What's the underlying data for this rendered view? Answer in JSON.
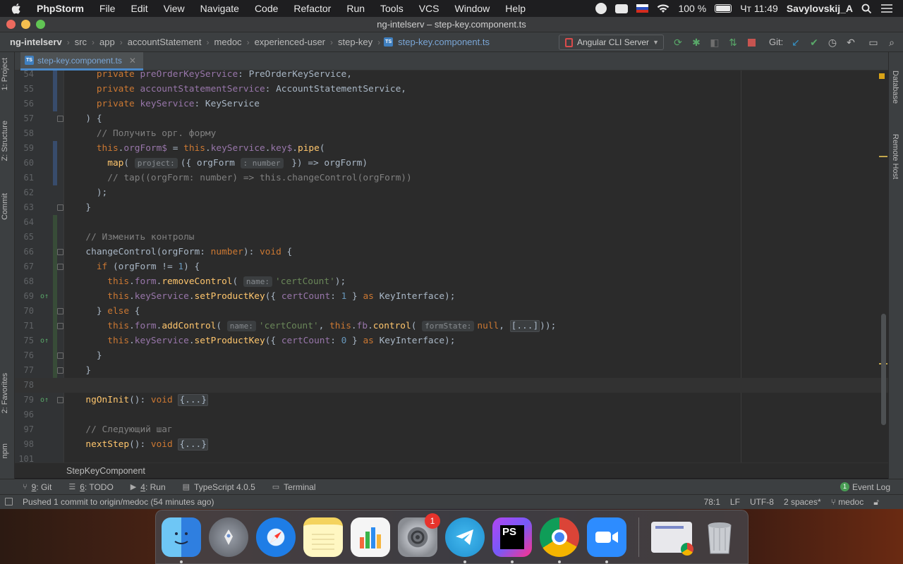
{
  "menubar": {
    "app_name": "PhpStorm",
    "items": [
      "File",
      "Edit",
      "View",
      "Navigate",
      "Code",
      "Refactor",
      "Run",
      "Tools",
      "VCS",
      "Window",
      "Help"
    ],
    "battery": "100 %",
    "clock": "Чт 11:49",
    "user": "Savylovskij_A"
  },
  "window": {
    "title": "ng-intelserv – step-key.component.ts"
  },
  "breadcrumbs": [
    "ng-intelserv",
    "src",
    "app",
    "accountStatement",
    "medoc",
    "experienced-user",
    "step-key",
    "step-key.component.ts"
  ],
  "toolbar": {
    "run_config": "Angular CLI Server",
    "git_label": "Git:"
  },
  "left_tools": [
    "1: Project",
    "Z: Structure",
    "Commit",
    "2: Favorites",
    "npm"
  ],
  "right_tools": [
    "Database",
    "Remote Host"
  ],
  "editor": {
    "tab_label": "step-key.component.ts",
    "lines": [
      {
        "n": "54",
        "vcs": "mod",
        "fold": false,
        "gm": "",
        "tokens": [
          [
            "    ",
            ""
          ],
          [
            "private ",
            "kw"
          ],
          [
            "preOrderKeyService",
            "fld"
          ],
          [
            ": PreOrderKeyService,",
            ""
          ]
        ]
      },
      {
        "n": "55",
        "vcs": "mod",
        "fold": false,
        "gm": "",
        "tokens": [
          [
            "    ",
            ""
          ],
          [
            "private ",
            "kw"
          ],
          [
            "accountStatementService",
            "fld"
          ],
          [
            ": AccountStatementService,",
            ""
          ]
        ]
      },
      {
        "n": "56",
        "vcs": "mod",
        "fold": false,
        "gm": "",
        "tokens": [
          [
            "    ",
            ""
          ],
          [
            "private ",
            "kw"
          ],
          [
            "keyService",
            "fld"
          ],
          [
            ": KeyService",
            ""
          ]
        ]
      },
      {
        "n": "57",
        "vcs": "",
        "fold": true,
        "gm": "",
        "tokens": [
          [
            "  ) {",
            ""
          ]
        ]
      },
      {
        "n": "58",
        "vcs": "",
        "fold": false,
        "gm": "",
        "tokens": [
          [
            "    ",
            ""
          ],
          [
            "// Получить орг. форму",
            "cm"
          ]
        ]
      },
      {
        "n": "59",
        "vcs": "mod",
        "fold": false,
        "gm": "",
        "tokens": [
          [
            "    ",
            ""
          ],
          [
            "this",
            "kw"
          ],
          [
            ".",
            ""
          ],
          [
            "orgForm$",
            "fld"
          ],
          [
            " = ",
            ""
          ],
          [
            "this",
            "kw"
          ],
          [
            ".",
            ""
          ],
          [
            "keyService",
            "fld"
          ],
          [
            ".",
            ""
          ],
          [
            "key$",
            "fld"
          ],
          [
            ".",
            ""
          ],
          [
            "pipe",
            "fn"
          ],
          [
            "(",
            ""
          ]
        ]
      },
      {
        "n": "60",
        "vcs": "mod",
        "fold": false,
        "gm": "",
        "tokens": [
          [
            "      ",
            ""
          ],
          [
            "map",
            "fn"
          ],
          [
            "( ",
            ""
          ],
          [
            "project:",
            "hint"
          ],
          [
            "({ orgForm ",
            ""
          ],
          [
            ": number",
            "hint"
          ],
          [
            " }) => orgForm)",
            ""
          ]
        ]
      },
      {
        "n": "61",
        "vcs": "mod",
        "fold": false,
        "gm": "",
        "tokens": [
          [
            "      ",
            ""
          ],
          [
            "// tap((orgForm: number) => this.changeControl(orgForm))",
            "cm"
          ]
        ]
      },
      {
        "n": "62",
        "vcs": "",
        "fold": false,
        "gm": "",
        "tokens": [
          [
            "    );",
            ""
          ]
        ]
      },
      {
        "n": "63",
        "vcs": "",
        "fold": true,
        "gm": "",
        "tokens": [
          [
            "  }",
            ""
          ]
        ]
      },
      {
        "n": "64",
        "vcs": "add",
        "fold": false,
        "gm": "",
        "tokens": [
          [
            "",
            ""
          ]
        ]
      },
      {
        "n": "65",
        "vcs": "add",
        "fold": false,
        "gm": "",
        "tokens": [
          [
            "  ",
            ""
          ],
          [
            "// Изменить контролы",
            "cm"
          ]
        ]
      },
      {
        "n": "66",
        "vcs": "add",
        "fold": true,
        "gm": "",
        "tokens": [
          [
            "  changeControl(orgForm: ",
            ""
          ],
          [
            "number",
            "kw"
          ],
          [
            "): ",
            ""
          ],
          [
            "void",
            "kw"
          ],
          [
            " {",
            ""
          ]
        ]
      },
      {
        "n": "67",
        "vcs": "add",
        "fold": true,
        "gm": "",
        "tokens": [
          [
            "    ",
            ""
          ],
          [
            "if",
            "kw"
          ],
          [
            " (orgForm != ",
            ""
          ],
          [
            "1",
            "num"
          ],
          [
            ") {",
            ""
          ]
        ]
      },
      {
        "n": "68",
        "vcs": "add",
        "fold": false,
        "gm": "",
        "tokens": [
          [
            "      ",
            ""
          ],
          [
            "this",
            "kw"
          ],
          [
            ".",
            ""
          ],
          [
            "form",
            "fld"
          ],
          [
            ".",
            ""
          ],
          [
            "removeControl",
            "fn"
          ],
          [
            "( ",
            ""
          ],
          [
            "name:",
            "hint"
          ],
          [
            "'certCount'",
            "str"
          ],
          [
            ");",
            ""
          ]
        ]
      },
      {
        "n": "69",
        "vcs": "add",
        "fold": false,
        "gm": "o↑",
        "tokens": [
          [
            "      ",
            ""
          ],
          [
            "this",
            "kw"
          ],
          [
            ".",
            ""
          ],
          [
            "keyService",
            "fld"
          ],
          [
            ".",
            ""
          ],
          [
            "setProductKey",
            "fn"
          ],
          [
            "({ ",
            ""
          ],
          [
            "certCount",
            "fld"
          ],
          [
            ": ",
            ""
          ],
          [
            "1",
            "num"
          ],
          [
            " } ",
            ""
          ],
          [
            "as",
            "kw"
          ],
          [
            " KeyInterface);",
            ""
          ]
        ]
      },
      {
        "n": "70",
        "vcs": "add",
        "fold": true,
        "gm": "",
        "tokens": [
          [
            "    } ",
            ""
          ],
          [
            "else",
            "kw"
          ],
          [
            " {",
            ""
          ]
        ]
      },
      {
        "n": "71",
        "vcs": "add",
        "fold": true,
        "gm": "",
        "tokens": [
          [
            "      ",
            ""
          ],
          [
            "this",
            "kw"
          ],
          [
            ".",
            ""
          ],
          [
            "form",
            "fld"
          ],
          [
            ".",
            ""
          ],
          [
            "addControl",
            "fn"
          ],
          [
            "( ",
            ""
          ],
          [
            "name:",
            "hint"
          ],
          [
            "'certCount'",
            "str"
          ],
          [
            ", ",
            ""
          ],
          [
            "this",
            "kw"
          ],
          [
            ".",
            ""
          ],
          [
            "fb",
            "fld"
          ],
          [
            ".",
            ""
          ],
          [
            "control",
            "fn"
          ],
          [
            "( ",
            ""
          ],
          [
            "formState:",
            "hint"
          ],
          [
            "null",
            "kw"
          ],
          [
            ", ",
            ""
          ],
          [
            "[...]",
            "foldtxt"
          ],
          [
            "));",
            ""
          ]
        ]
      },
      {
        "n": "75",
        "vcs": "add",
        "fold": false,
        "gm": "o↑",
        "tokens": [
          [
            "      ",
            ""
          ],
          [
            "this",
            "kw"
          ],
          [
            ".",
            ""
          ],
          [
            "keyService",
            "fld"
          ],
          [
            ".",
            ""
          ],
          [
            "setProductKey",
            "fn"
          ],
          [
            "({ ",
            ""
          ],
          [
            "certCount",
            "fld"
          ],
          [
            ": ",
            ""
          ],
          [
            "0",
            "num"
          ],
          [
            " } ",
            ""
          ],
          [
            "as",
            "kw"
          ],
          [
            " KeyInterface);",
            ""
          ]
        ]
      },
      {
        "n": "76",
        "vcs": "add",
        "fold": true,
        "gm": "",
        "tokens": [
          [
            "    }",
            ""
          ]
        ]
      },
      {
        "n": "77",
        "vcs": "add",
        "fold": true,
        "gm": "",
        "tokens": [
          [
            "  }",
            ""
          ]
        ]
      },
      {
        "n": "78",
        "vcs": "",
        "fold": false,
        "gm": "",
        "cur": true,
        "tokens": [
          [
            "",
            ""
          ]
        ]
      },
      {
        "n": "79",
        "vcs": "",
        "fold": true,
        "gm": "o↑",
        "tokens": [
          [
            "  ",
            ""
          ],
          [
            "ngOnInit",
            "fn"
          ],
          [
            "(): ",
            ""
          ],
          [
            "void",
            "kw"
          ],
          [
            " ",
            ""
          ],
          [
            "{...}",
            "foldtxt"
          ]
        ]
      },
      {
        "n": "96",
        "vcs": "",
        "fold": false,
        "gm": "",
        "tokens": [
          [
            "",
            ""
          ]
        ]
      },
      {
        "n": "97",
        "vcs": "",
        "fold": false,
        "gm": "",
        "tokens": [
          [
            "  ",
            ""
          ],
          [
            "// Следующий шаг",
            "cm"
          ]
        ]
      },
      {
        "n": "98",
        "vcs": "",
        "fold": false,
        "gm": "",
        "tokens": [
          [
            "  ",
            ""
          ],
          [
            "nextStep",
            "fn"
          ],
          [
            "(): ",
            ""
          ],
          [
            "void",
            "kw"
          ],
          [
            " ",
            ""
          ],
          [
            "{...}",
            "foldtxt"
          ]
        ]
      },
      {
        "n": "101",
        "vcs": "",
        "fold": false,
        "gm": "",
        "tokens": [
          [
            "",
            ""
          ]
        ]
      }
    ]
  },
  "structure_crumb": "StepKeyComponent",
  "tool_windows": [
    {
      "key": "9",
      "label": ": Git"
    },
    {
      "key": "6",
      "label": ": TODO"
    },
    {
      "key": "4",
      "label": ": Run"
    },
    {
      "key": "",
      "label": "TypeScript 4.0.5"
    },
    {
      "key": "",
      "label": "Terminal"
    }
  ],
  "event_log": {
    "count": "1",
    "label": "Event Log"
  },
  "status": {
    "message": "Pushed 1 commit to origin/medoc (54 minutes ago)",
    "position": "78:1",
    "line_sep": "LF",
    "encoding": "UTF-8",
    "indent": "2 spaces*",
    "branch": "medoc"
  },
  "dock": {
    "apps": [
      {
        "name": "finder",
        "bg": "#3b8eea",
        "running": true
      },
      {
        "name": "launchpad",
        "bg": "#6d7078",
        "running": false
      },
      {
        "name": "safari",
        "bg": "#1e7de6",
        "running": false
      },
      {
        "name": "notes",
        "bg": "#f4d35e",
        "running": false
      },
      {
        "name": "numbers",
        "bg": "#ffffff",
        "running": false
      },
      {
        "name": "system-preferences",
        "bg": "#8a8d93",
        "running": false,
        "badge": "1"
      },
      {
        "name": "telegram",
        "bg": "#2aa3dd",
        "running": true
      },
      {
        "name": "phpstorm",
        "bg": "#b345f1",
        "running": true
      },
      {
        "name": "chrome",
        "bg": "#ffffff",
        "running": true
      },
      {
        "name": "zoom",
        "bg": "#2d8cff",
        "running": true
      }
    ]
  }
}
